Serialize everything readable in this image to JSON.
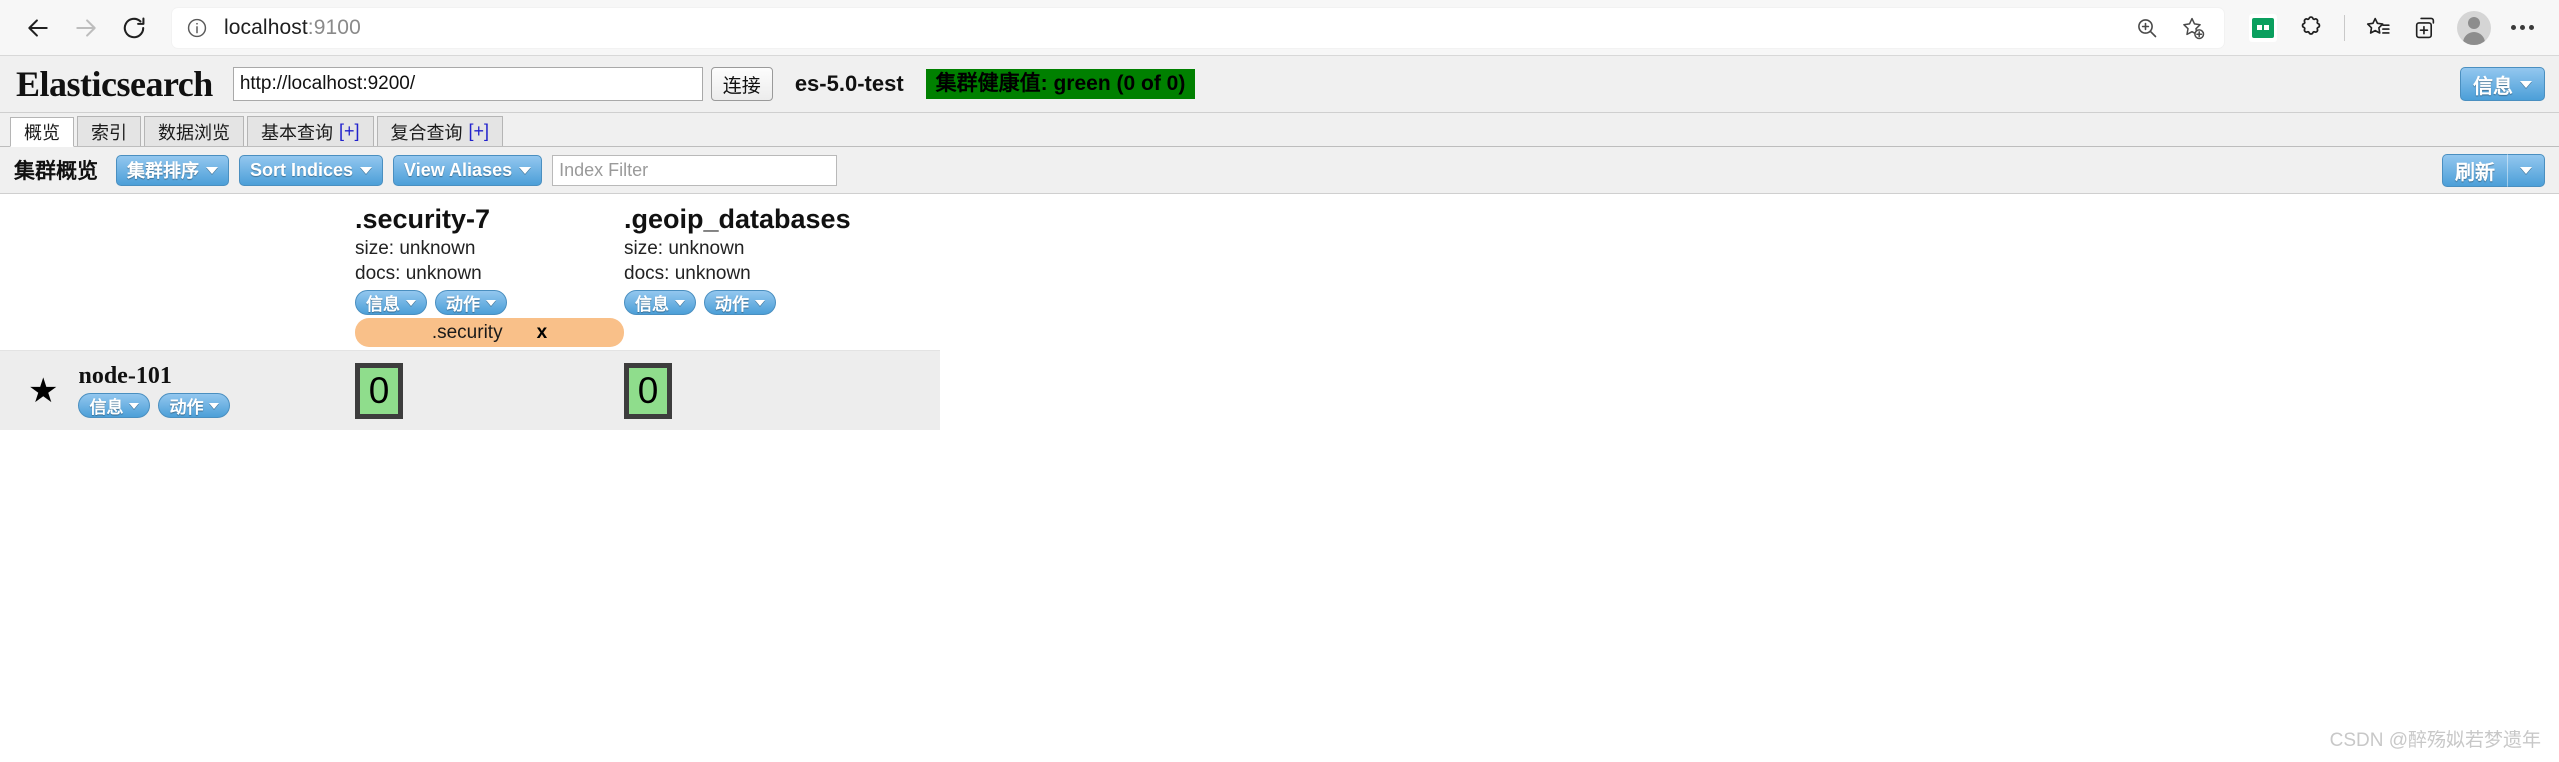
{
  "browser": {
    "back_label": "Back",
    "forward_label": "Forward",
    "reload_label": "Refresh",
    "site_info_label": "View site information",
    "url_main": "localhost",
    "url_port": ":9100",
    "zoom_label": "Zoom",
    "add_favorite_label": "Add this page to favorites",
    "app_label": "App",
    "extensions_label": "Extensions",
    "favorites_label": "Favorites",
    "split_screen_label": "Split screen",
    "profile_label": "Profile",
    "settings_label": "Settings and more"
  },
  "es": {
    "logo": "Elasticsearch",
    "connect_url": "http://localhost:9200/",
    "connect_button": "连接",
    "cluster_name": "es-5.0-test",
    "health_text": "集群健康值: green (0 of 0)",
    "health_color": "#008000",
    "info_button": "信息",
    "tabs": [
      {
        "label": "概览",
        "plus": "",
        "active": true
      },
      {
        "label": "索引",
        "plus": "",
        "active": false
      },
      {
        "label": "数据浏览",
        "plus": "",
        "active": false
      },
      {
        "label": "基本查询",
        "plus": "[+]",
        "active": false
      },
      {
        "label": "复合查询",
        "plus": "[+]",
        "active": false
      }
    ],
    "toolbar": {
      "title": "集群概览",
      "sort_cluster": "集群排序",
      "sort_indices": "Sort Indices",
      "view_aliases": "View Aliases",
      "index_filter_value": "",
      "index_filter_placeholder": "Index Filter",
      "refresh": "刷新"
    },
    "indices": [
      {
        "name": ".security-7",
        "size": "size: unknown",
        "docs": "docs: unknown",
        "info_button": "信息",
        "action_button": "动作",
        "alias": {
          "name": ".security",
          "close": "x"
        },
        "shard": "0"
      },
      {
        "name": ".geoip_databases",
        "size": "size: unknown",
        "docs": "docs: unknown",
        "info_button": "信息",
        "action_button": "动作",
        "alias": null,
        "shard": "0"
      }
    ],
    "node": {
      "star": "★",
      "name": "node-101",
      "info_button": "信息",
      "action_button": "动作"
    }
  },
  "watermark": "CSDN @醉殇姒若梦遗年"
}
